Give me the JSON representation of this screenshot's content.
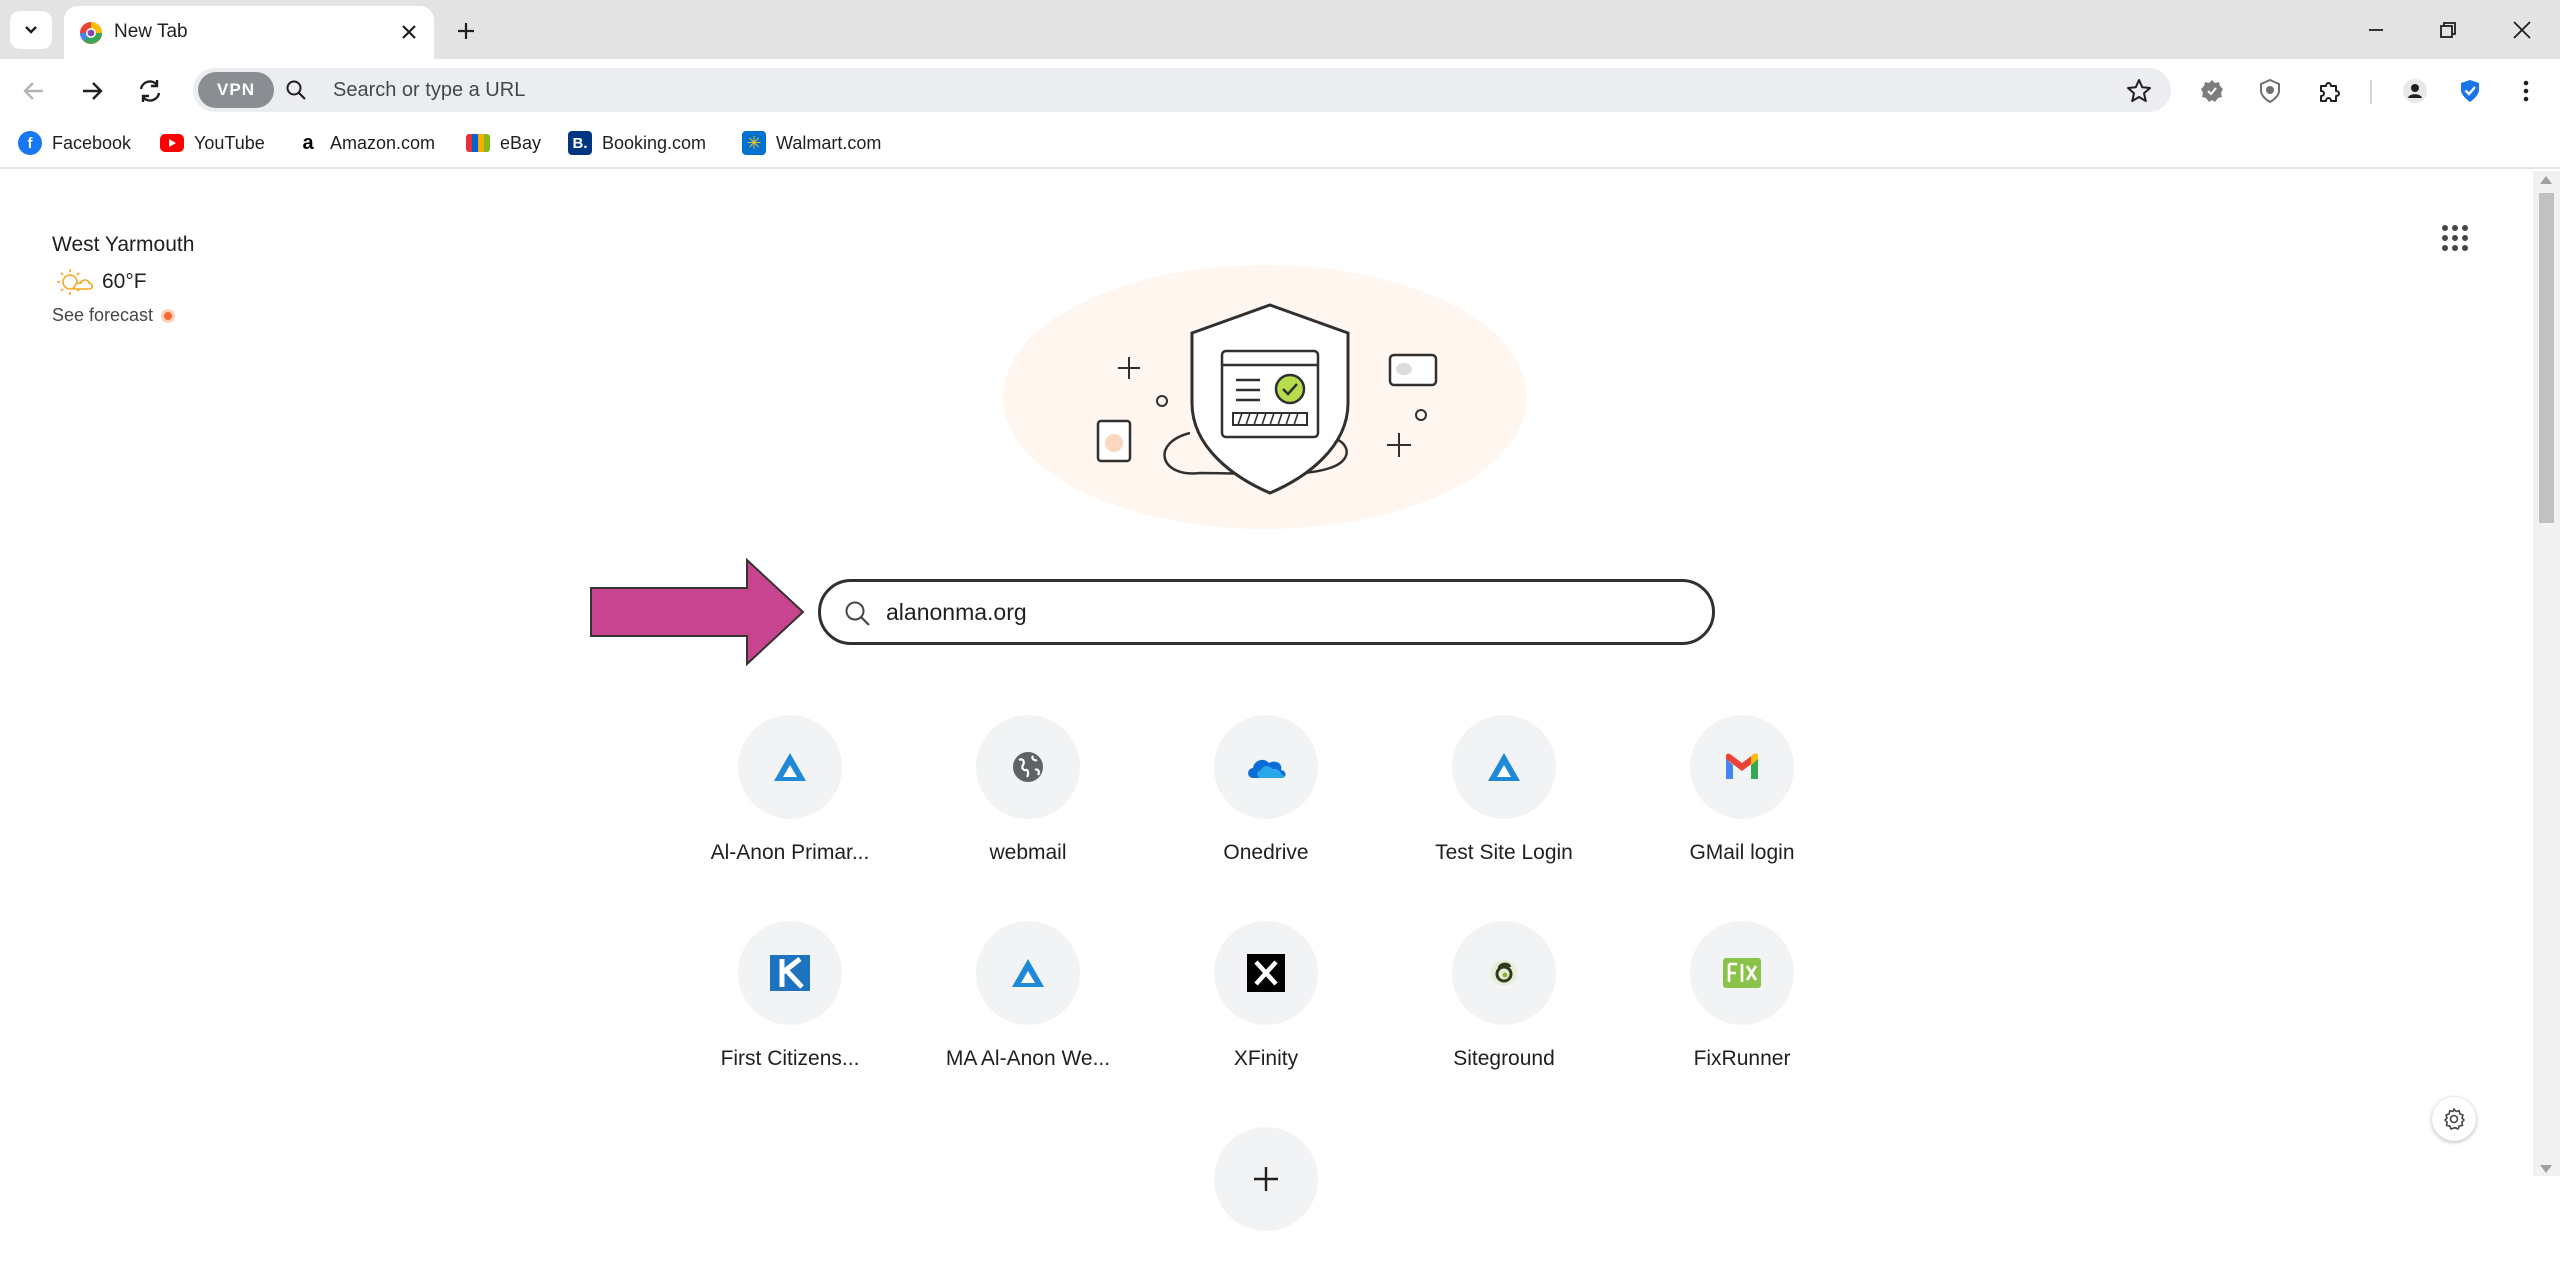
{
  "browser": {
    "tab": {
      "title": "New Tab"
    },
    "omnibox": {
      "vpn_label": "VPN",
      "placeholder": "Search or type a URL"
    },
    "bookmarks": [
      {
        "label": "Facebook",
        "icon": "facebook-icon",
        "color": "#1877f2"
      },
      {
        "label": "YouTube",
        "icon": "youtube-icon",
        "color": "#ff0000"
      },
      {
        "label": "Amazon.com",
        "icon": "amazon-icon",
        "color": "#000000"
      },
      {
        "label": "eBay",
        "icon": "ebay-icon",
        "color": "#e53238"
      },
      {
        "label": "Booking.com",
        "icon": "booking-icon",
        "color": "#003580"
      },
      {
        "label": "Walmart.com",
        "icon": "walmart-icon",
        "color": "#0071ce"
      }
    ]
  },
  "weather": {
    "city": "West Yarmouth",
    "temperature": "60°F",
    "forecast_link": "See forecast"
  },
  "search": {
    "value": "alanonma.org"
  },
  "shortcuts": [
    {
      "label": "Al-Anon Primar...",
      "icon": "al-anon-icon"
    },
    {
      "label": "webmail",
      "icon": "globe-icon"
    },
    {
      "label": "Onedrive",
      "icon": "onedrive-icon"
    },
    {
      "label": "Test Site Login",
      "icon": "al-anon-icon"
    },
    {
      "label": "GMail login",
      "icon": "gmail-icon"
    },
    {
      "label": "First Citizens...",
      "icon": "first-citizens-icon"
    },
    {
      "label": "MA Al-Anon We...",
      "icon": "al-anon-icon"
    },
    {
      "label": "XFinity",
      "icon": "xfinity-icon"
    },
    {
      "label": "Siteground",
      "icon": "siteground-icon"
    },
    {
      "label": "FixRunner",
      "icon": "fixrunner-icon"
    }
  ],
  "colors": {
    "accent_arrow": "#c8448f",
    "tabstrip_bg": "#e3e3e3",
    "omnibox_bg": "#ebedf0",
    "tile_bg": "#f1f3f4"
  }
}
